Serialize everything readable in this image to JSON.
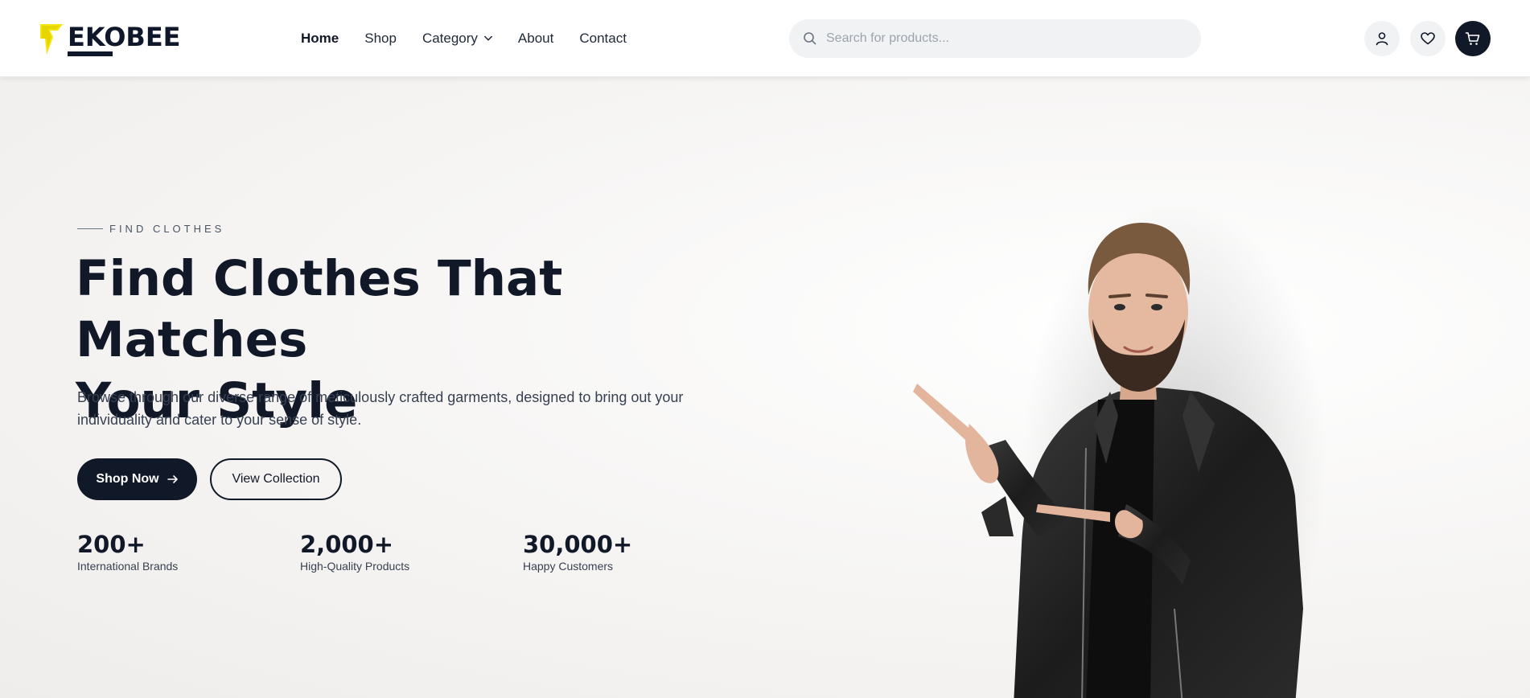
{
  "header": {
    "logo_text": "EKOBEE",
    "nav": [
      {
        "label": "Home",
        "active": true
      },
      {
        "label": "Shop"
      },
      {
        "label": "Category",
        "has_dropdown": true
      },
      {
        "label": "About"
      },
      {
        "label": "Contact"
      }
    ],
    "search": {
      "placeholder": "Search for products..."
    },
    "icons": [
      "user-icon",
      "heart-icon",
      "cart-icon"
    ]
  },
  "hero": {
    "eyebrow": "FIND CLOTHES",
    "headline_line1": "Find Clothes That Matches",
    "headline_line2": "Your Style",
    "description": "Browse through our diverse range of meticulously crafted garments, designed to bring out your individuality and cater to your sense of style.",
    "primary_button": "Shop Now",
    "secondary_button": "View Collection",
    "stats": [
      {
        "value": "200+",
        "label": "International Brands"
      },
      {
        "value": "2,000+",
        "label": "High-Quality Products"
      },
      {
        "value": "30,000+",
        "label": "Happy Customers"
      }
    ]
  },
  "colors": {
    "primary": "#111827",
    "accent": "#f5e50a",
    "background": "#f6f5f4"
  }
}
